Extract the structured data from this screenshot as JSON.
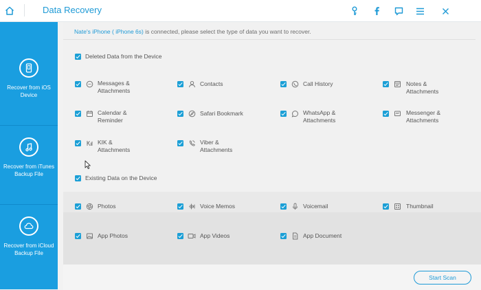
{
  "app": {
    "title": "Data Recovery"
  },
  "toolbar": {
    "icons": [
      "key-icon",
      "facebook-icon",
      "feedback-icon",
      "menu-icon",
      "close-icon"
    ]
  },
  "sidebar": {
    "items": [
      {
        "label": "Recover from iOS Device",
        "icon": "phone-icon"
      },
      {
        "label": "Recover from iTunes Backup File",
        "icon": "music-note-icon"
      },
      {
        "label": "Recover from iCloud Backup File",
        "icon": "cloud-icon"
      }
    ]
  },
  "notice": {
    "device": "Nate's iPhone ( iPhone 6s)",
    "message": " is connected, please select the type of data you want to recover."
  },
  "sections": {
    "deleted": "Deleted Data from the Device",
    "existing": "Existing Data on the Device"
  },
  "deleted_items": [
    {
      "label": "Messages &\nAttachments",
      "icon": "message-icon",
      "checked": true
    },
    {
      "label": "Contacts",
      "icon": "contacts-icon",
      "checked": true
    },
    {
      "label": "Call History",
      "icon": "call-history-icon",
      "checked": true
    },
    {
      "label": "Notes &\nAttachments",
      "icon": "notes-icon",
      "checked": true
    },
    {
      "label": "Calendar &\nReminder",
      "icon": "calendar-icon",
      "checked": true
    },
    {
      "label": "Safari Bookmark",
      "icon": "safari-icon",
      "checked": true
    },
    {
      "label": "WhatsApp &\nAttachments",
      "icon": "whatsapp-icon",
      "checked": true
    },
    {
      "label": "Messenger &\nAttachments",
      "icon": "messenger-icon",
      "checked": true
    },
    {
      "label": "KIK &\nAttachments",
      "icon": "kik-icon",
      "checked": true
    },
    {
      "label": "Viber &\nAttachments",
      "icon": "viber-icon",
      "checked": true
    }
  ],
  "existing_items": [
    {
      "label": "Photos",
      "icon": "photos-icon",
      "checked": true
    },
    {
      "label": "Voice Memos",
      "icon": "voice-memos-icon",
      "checked": true
    },
    {
      "label": "Voicemail",
      "icon": "voicemail-icon",
      "checked": true
    },
    {
      "label": "Thumbnail",
      "icon": "thumbnail-icon",
      "checked": true
    },
    {
      "label": "App Photos",
      "icon": "app-photos-icon",
      "checked": true
    },
    {
      "label": "App Videos",
      "icon": "app-videos-icon",
      "checked": true
    },
    {
      "label": "App Document",
      "icon": "app-document-icon",
      "checked": true
    }
  ],
  "actions": {
    "start_scan": "Start Scan"
  },
  "colors": {
    "accent": "#1a9ee0",
    "checkbox": "#1b9fd6"
  }
}
